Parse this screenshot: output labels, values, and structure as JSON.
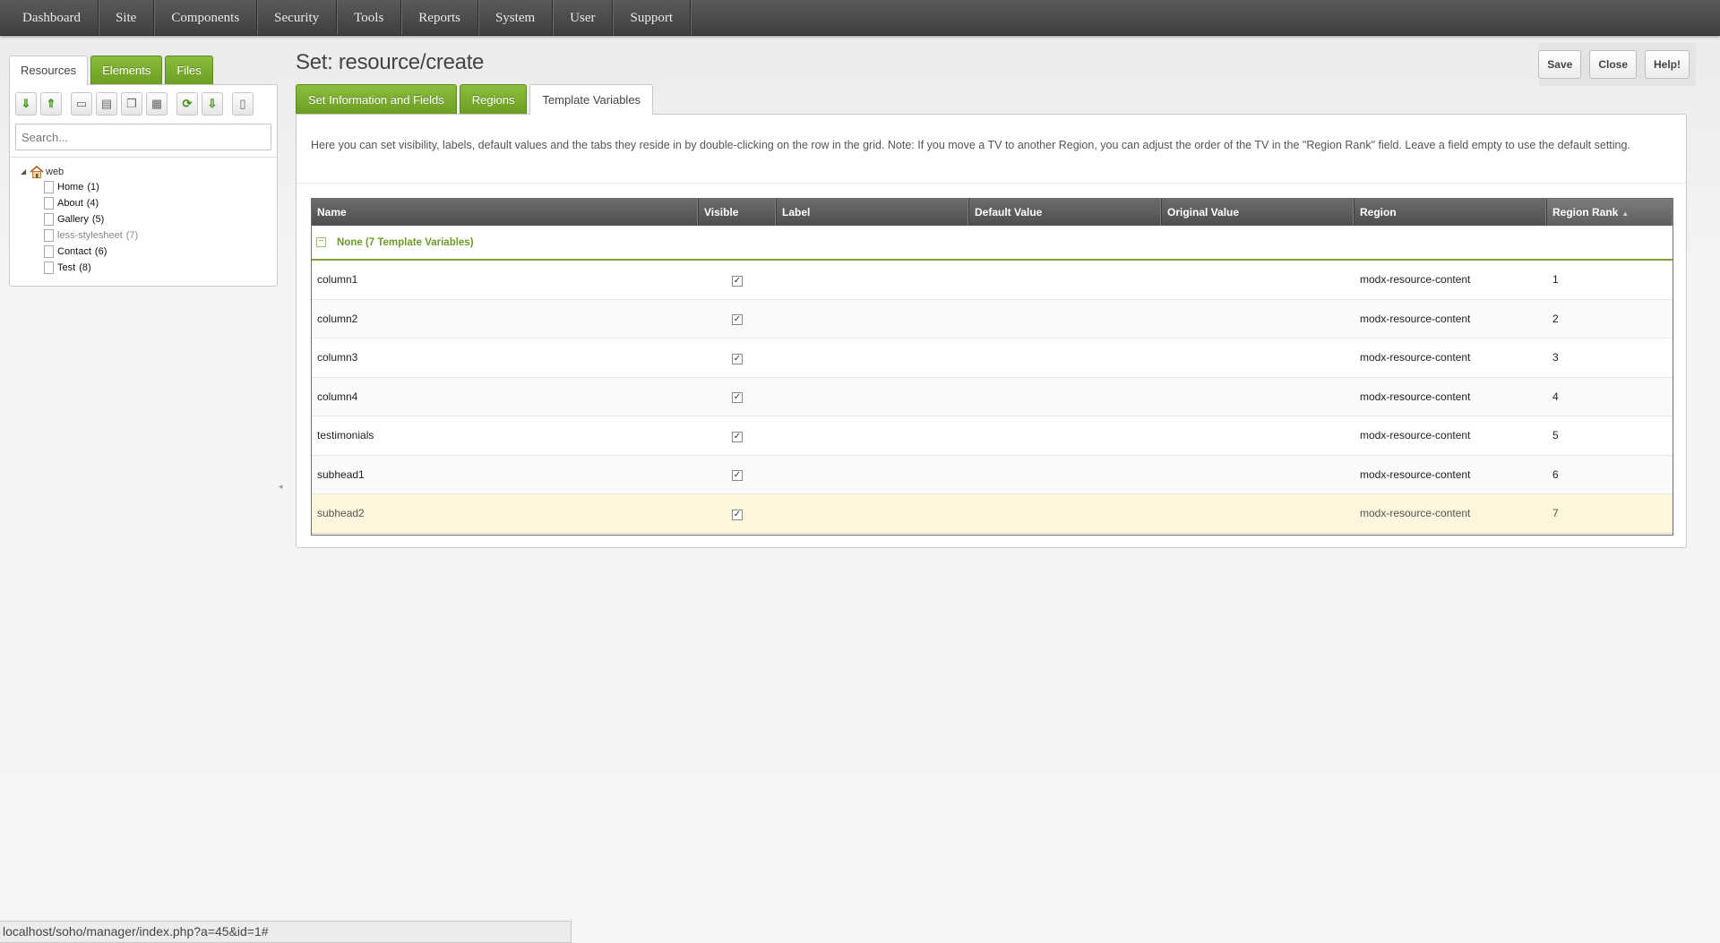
{
  "topnav": {
    "items": [
      "Dashboard",
      "Site",
      "Components",
      "Security",
      "Tools",
      "Reports",
      "System",
      "User",
      "Support"
    ]
  },
  "left": {
    "tabs": [
      "Resources",
      "Elements",
      "Files"
    ],
    "toolbar_icons": [
      "arrow-down-icon",
      "arrow-up-icon",
      "new-folder-icon",
      "new-weblink-icon",
      "new-symlink-icon",
      "new-static-icon",
      "refresh-icon",
      "sort-icon",
      "trash-icon"
    ],
    "search_placeholder": "Search...",
    "tree": {
      "root": "web",
      "items": [
        {
          "label": "Home",
          "count": "(1)",
          "unpublished": false
        },
        {
          "label": "About",
          "count": "(4)",
          "unpublished": false
        },
        {
          "label": "Gallery",
          "count": "(5)",
          "unpublished": false
        },
        {
          "label": "less-stylesheet",
          "count": "(7)",
          "unpublished": true
        },
        {
          "label": "Contact",
          "count": "(6)",
          "unpublished": false
        },
        {
          "label": "Test",
          "count": "(8)",
          "unpublished": false
        }
      ]
    }
  },
  "main": {
    "title": "Set: resource/create",
    "actions": {
      "save": "Save",
      "close": "Close",
      "help": "Help!"
    },
    "tabs": [
      "Set Information and Fields",
      "Regions",
      "Template Variables"
    ],
    "active_tab": 2,
    "description": "Here you can set visibility, labels, default values and the tabs they reside in by double-clicking on the row in the grid. Note: If you move a TV to another Region, you can adjust the order of the TV in the \"Region Rank\" field. Leave a field empty to use the default setting."
  },
  "grid": {
    "columns": [
      "Name",
      "Visible",
      "Label",
      "Default Value",
      "Original Value",
      "Region",
      "Region Rank"
    ],
    "group_label": "None (7 Template Variables)",
    "group_toggle": "−",
    "checkmark": "✓",
    "rows": [
      {
        "name": "column1",
        "visible": true,
        "label": "",
        "default_value": "",
        "original_value": "",
        "region": "modx-resource-content",
        "rank": "1"
      },
      {
        "name": "column2",
        "visible": true,
        "label": "",
        "default_value": "",
        "original_value": "",
        "region": "modx-resource-content",
        "rank": "2"
      },
      {
        "name": "column3",
        "visible": true,
        "label": "",
        "default_value": "",
        "original_value": "",
        "region": "modx-resource-content",
        "rank": "3"
      },
      {
        "name": "column4",
        "visible": true,
        "label": "",
        "default_value": "",
        "original_value": "",
        "region": "modx-resource-content",
        "rank": "4"
      },
      {
        "name": "testimonials",
        "visible": true,
        "label": "",
        "default_value": "",
        "original_value": "",
        "region": "modx-resource-content",
        "rank": "5"
      },
      {
        "name": "subhead1",
        "visible": true,
        "label": "",
        "default_value": "",
        "original_value": "",
        "region": "modx-resource-content",
        "rank": "6"
      },
      {
        "name": "subhead2",
        "visible": true,
        "label": "",
        "default_value": "",
        "original_value": "",
        "region": "modx-resource-content",
        "rank": "7",
        "selected": true
      }
    ]
  },
  "statusbar": {
    "url": "localhost/soho/manager/index.php?a=45&id=1#"
  },
  "colors": {
    "accent_green": "#6a9e22",
    "group_green": "#6b9a2a",
    "selected_row": "#fdf6dc"
  }
}
